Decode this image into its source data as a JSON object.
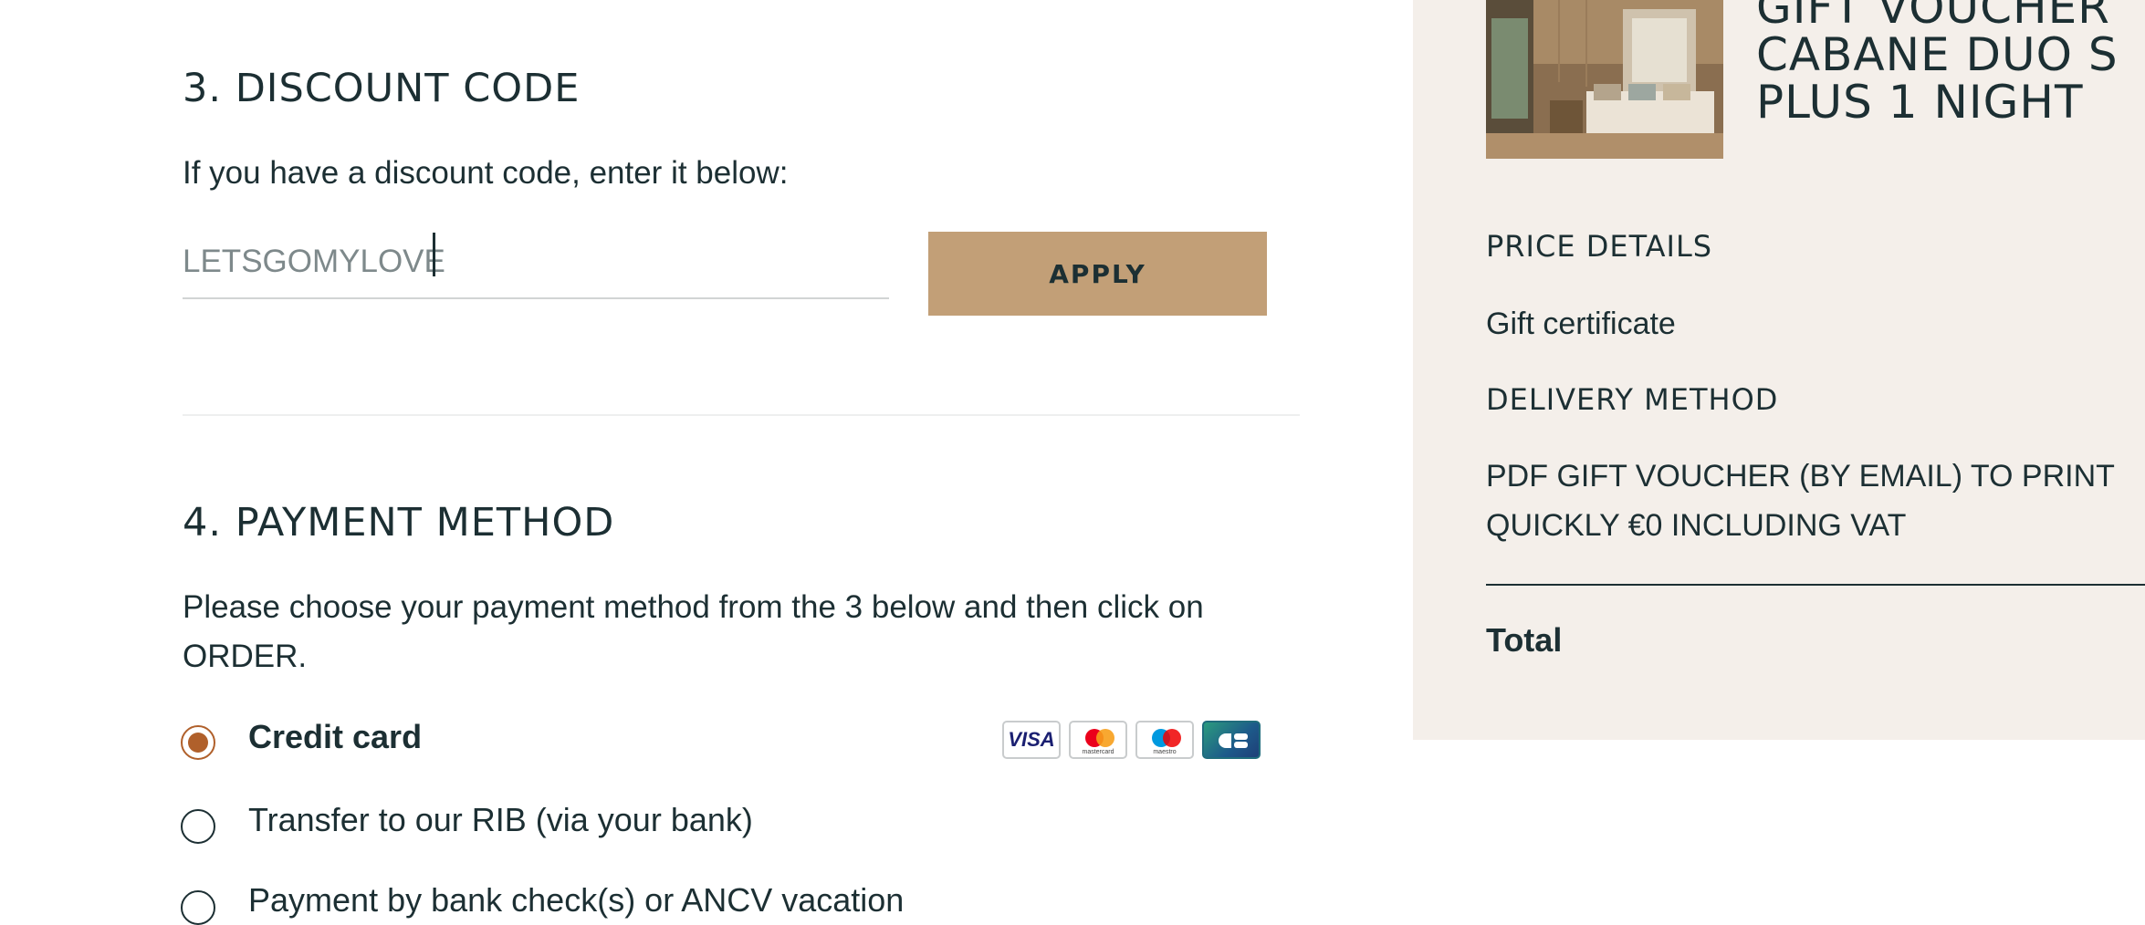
{
  "discount": {
    "heading": "3. DISCOUNT CODE",
    "instruction": "If you have a discount code, enter it below:",
    "code_value": "LETSGOMYLOVE",
    "apply_label": "APPLY"
  },
  "payment": {
    "heading": "4. PAYMENT METHOD",
    "instruction": "Please choose your payment method from the 3 below and then click on ORDER.",
    "options": [
      {
        "label": "Credit card",
        "selected": true
      },
      {
        "label": "Transfer to our RIB (via your bank)",
        "selected": false
      },
      {
        "label": "Payment by bank check(s) or ANCV vacation",
        "selected": false
      }
    ],
    "card_logos": [
      {
        "icon": "visa-logo-icon",
        "text": "VISA"
      },
      {
        "icon": "mastercard-logo-icon",
        "text": "mastercard"
      },
      {
        "icon": "maestro-logo-icon",
        "text": "maestro"
      },
      {
        "icon": "cb-logo-icon",
        "text": ""
      }
    ],
    "accent_color": "#b0602b"
  },
  "summary": {
    "product_title_lines": [
      "GIFT VOUCHER",
      "CABANE DUO S",
      "PLUS 1 NIGHT"
    ],
    "price_details_label": "PRICE DETAILS",
    "price_details_value": "Gift certificate",
    "delivery_label": "DELIVERY METHOD",
    "delivery_value": "PDF GIFT VOUCHER (BY EMAIL) TO PRINT QUICKLY €0 INCLUDING VAT",
    "total_label": "Total",
    "background_color": "#f4efea"
  },
  "colors": {
    "text": "#1c2f33",
    "button": "#c29f77"
  }
}
